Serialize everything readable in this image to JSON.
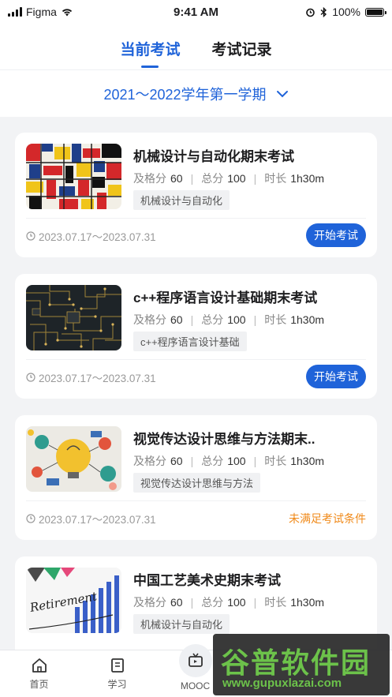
{
  "status_bar": {
    "carrier": "Figma",
    "time": "9:41 AM",
    "battery": "100%"
  },
  "tabs": [
    {
      "label": "当前考试",
      "active": true
    },
    {
      "label": "考试记录",
      "active": false
    }
  ],
  "semester": {
    "label": "2021～2022学年第一学期"
  },
  "labels": {
    "pass": "及格分",
    "total": "总分",
    "duration": "时长"
  },
  "exams": [
    {
      "title": "机械设计与自动化期末考试",
      "pass_score": "60",
      "total_score": "100",
      "duration": "1h30m",
      "tag": "机械设计与自动化",
      "date": "2023.07.17～2023.07.31",
      "action": "开始考试",
      "action_type": "button",
      "thumb": "mondrian-image"
    },
    {
      "title": "c++程序语言设计基础期末考试",
      "pass_score": "60",
      "total_score": "100",
      "duration": "1h30m",
      "tag": "c++程序语言设计基础",
      "date": "2023.07.17～2023.07.31",
      "action": "开始考试",
      "action_type": "button",
      "thumb": "circuit-board-image"
    },
    {
      "title": "视觉传达设计思维与方法期末..",
      "pass_score": "60",
      "total_score": "100",
      "duration": "1h30m",
      "tag": "视觉传达设计思维与方法",
      "date": "2023.07.17～2023.07.31",
      "action": "未满足考试条件",
      "action_type": "text",
      "thumb": "lightbulb-image"
    },
    {
      "title": "中国工艺美术史期末考试",
      "pass_score": "60",
      "total_score": "100",
      "duration": "1h30m",
      "tag": "机械设计与自动化",
      "date": "",
      "action": "",
      "action_type": "none",
      "thumb": "retirement-chart-image"
    }
  ],
  "nav": [
    {
      "label": "首页",
      "icon": "home-icon"
    },
    {
      "label": "学习",
      "icon": "book-icon"
    },
    {
      "label": "MOOC",
      "icon": "tv-icon"
    },
    {
      "label": "",
      "icon": ""
    },
    {
      "label": "",
      "icon": ""
    }
  ],
  "watermark": {
    "text": "谷普软件园",
    "url": "www.gupuxlazai.com"
  },
  "colors": {
    "primary": "#1f63d9",
    "warning": "#f08a1a",
    "background": "#f2f3f5"
  }
}
